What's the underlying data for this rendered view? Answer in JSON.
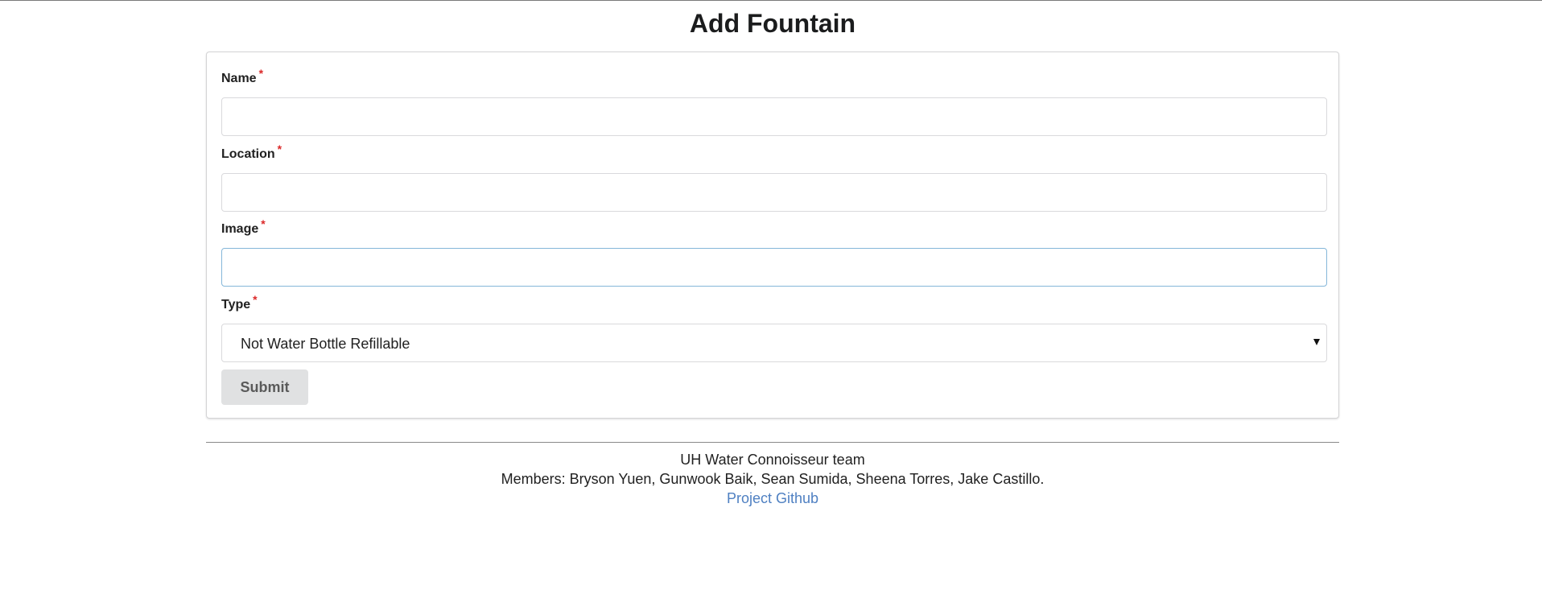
{
  "page": {
    "title": "Add Fountain"
  },
  "form": {
    "required_marker": "*",
    "fields": [
      {
        "label": "Name",
        "value": ""
      },
      {
        "label": "Location",
        "value": ""
      },
      {
        "label": "Image",
        "value": ""
      },
      {
        "label": "Type",
        "selected": "Not Water Bottle Refillable"
      }
    ],
    "submit_label": "Submit"
  },
  "footer": {
    "team": "UH Water Connoisseur team",
    "members": "Members: Bryson Yuen, Gunwook Baik, Sean Sumida, Sheena Torres, Jake Castillo.",
    "link_label": "Project Github"
  },
  "colors": {
    "required": "#db2828",
    "link": "#4f80c2",
    "focus_border": "#85b7d9",
    "button_bg": "#e0e1e2"
  }
}
